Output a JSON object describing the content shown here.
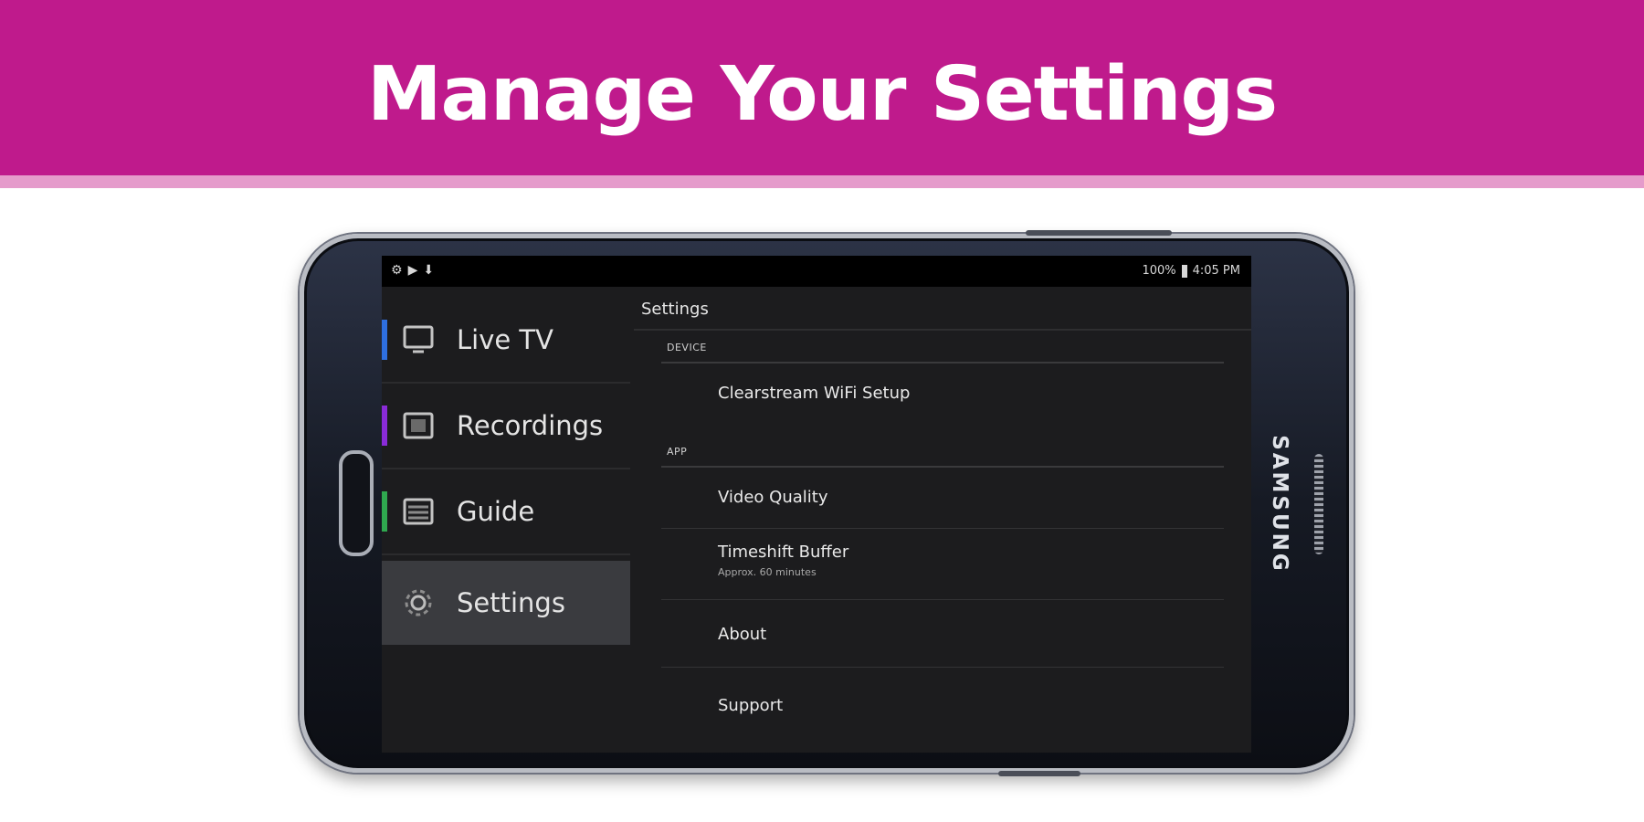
{
  "banner": {
    "title": "Manage Your Settings",
    "bg_color": "#bf1a8c",
    "stripe_color": "#e59bcb"
  },
  "device": {
    "brand": "SAMSUNG"
  },
  "status_bar": {
    "left_icons": [
      "settings-status-icon",
      "play-store-icon",
      "download-icon"
    ],
    "battery": "100%",
    "time": "4:05 PM"
  },
  "nav": {
    "items": [
      {
        "label": "Live TV",
        "icon": "tv-icon",
        "accent": "#2e6fe0",
        "active": false
      },
      {
        "label": "Recordings",
        "icon": "recording-icon",
        "accent": "#8a2bd8",
        "active": false
      },
      {
        "label": "Guide",
        "icon": "guide-icon",
        "accent": "#2fa84f",
        "active": false
      },
      {
        "label": "Settings",
        "icon": "gear-icon",
        "accent": "",
        "active": true
      }
    ]
  },
  "settings": {
    "title": "Settings",
    "sections": [
      {
        "label": "DEVICE",
        "rows": [
          {
            "label": "Clearstream WiFi Setup",
            "sub": ""
          }
        ]
      },
      {
        "label": "APP",
        "rows": [
          {
            "label": "Video Quality",
            "sub": ""
          },
          {
            "label": "Timeshift Buffer",
            "sub": "Approx. 60 minutes"
          },
          {
            "label": "About",
            "sub": ""
          },
          {
            "label": "Support",
            "sub": ""
          }
        ]
      }
    ]
  }
}
